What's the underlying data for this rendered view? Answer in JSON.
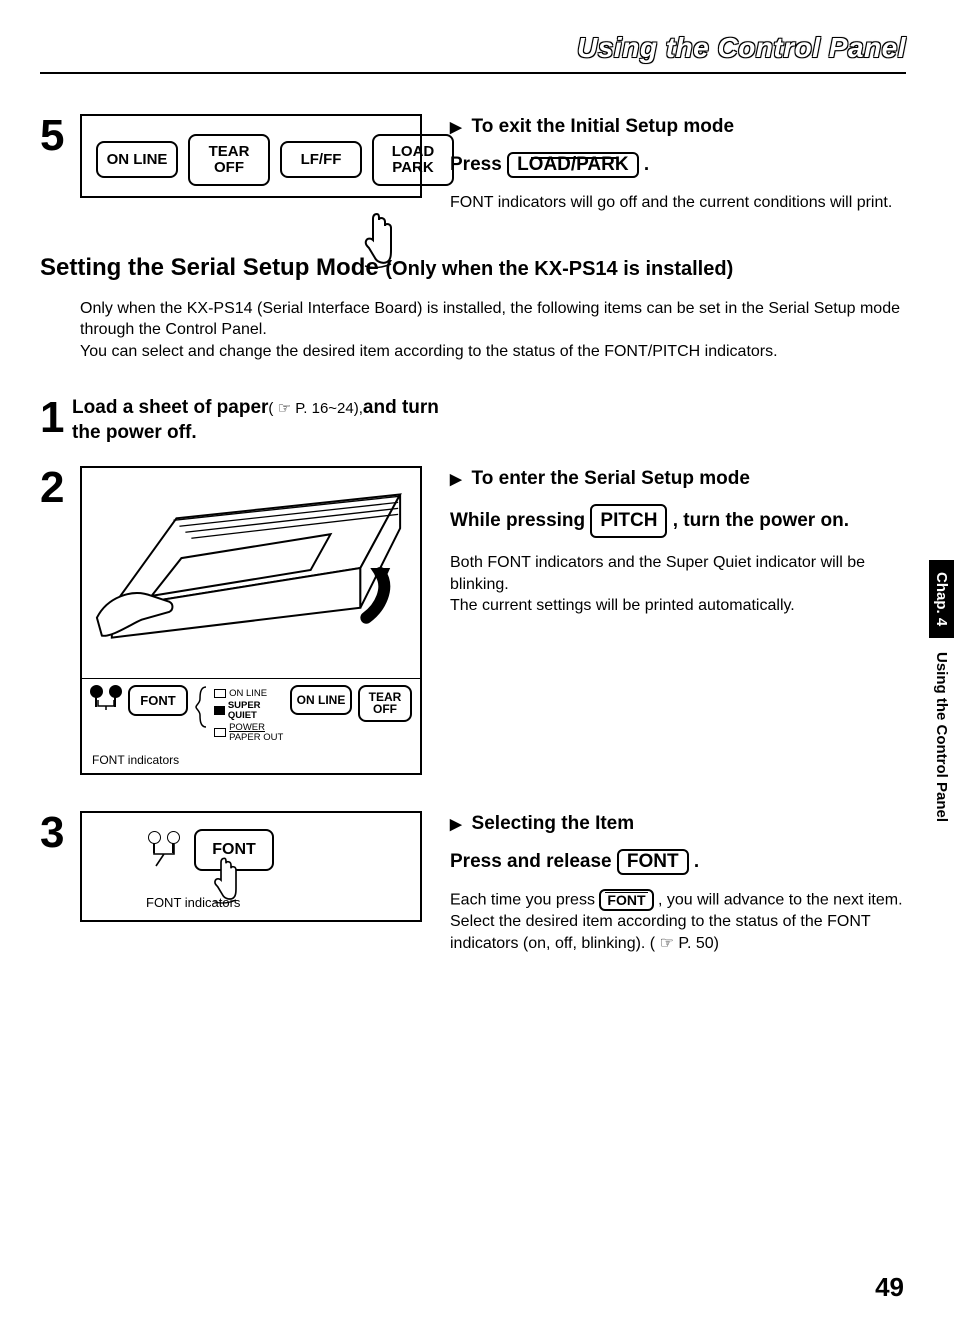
{
  "header": {
    "title": "Using the Control Panel"
  },
  "step5": {
    "num": "5",
    "buttons": {
      "online": "ON LINE",
      "tear_top": "TEAR",
      "tear_bot": "OFF",
      "lfff": "LF/FF",
      "load_top": "LOAD",
      "load_bot": "PARK"
    },
    "heading": "To exit the Initial Setup mode",
    "press_prefix": "Press",
    "press_key": "LOAD/PARK",
    "press_suffix": ".",
    "body": "FONT indicators will go off and the current conditions will print."
  },
  "section": {
    "title_main": "Setting the Serial Setup Mode",
    "title_sub": "(Only when the KX-PS14 is installed)",
    "intro1": "Only when the KX-PS14 (Serial Interface Board) is installed, the following items can be set in the Serial Setup mode through the Control Panel.",
    "intro2": "You can select and change the desired item according to the status of the FONT/PITCH indicators."
  },
  "step1": {
    "num": "1",
    "text_bold_a": "Load a sheet of paper",
    "text_paren": " ( ☞ P. 16~24), ",
    "text_bold_b": "and turn the power off."
  },
  "step2": {
    "num": "2",
    "panel": {
      "font": "FONT",
      "online_l": "ON LINE",
      "super_l": "SUPER QUIET",
      "power_l": "POWER",
      "paper_l": "PAPER OUT",
      "online": "ON LINE",
      "tear_top": "TEAR",
      "tear_bot": "OFF",
      "ind_label": "FONT indicators"
    },
    "heading": "To enter the Serial Setup mode",
    "line_a": "While pressing ",
    "key": "PITCH",
    "line_b": " , turn the power on.",
    "body1": "Both FONT indicators and the Super Quiet indicator will be blinking.",
    "body2": "The current settings will be printed automatically."
  },
  "step3": {
    "num": "3",
    "font_btn": "FONT",
    "ind_label": "FONT indicators",
    "heading": "Selecting the Item",
    "press_prefix": "Press and release",
    "press_key": "FONT",
    "press_suffix": ".",
    "body_a": "Each time you press ",
    "body_key": "FONT",
    "body_b": " , you will advance to the next item. Select the desired item according to the status of the FONT indicators (on, off, blinking). ( ☞ P. 50)"
  },
  "sidetab": {
    "chap": "Chap. 4",
    "title": "Using the Control Panel"
  },
  "page_number": "49"
}
